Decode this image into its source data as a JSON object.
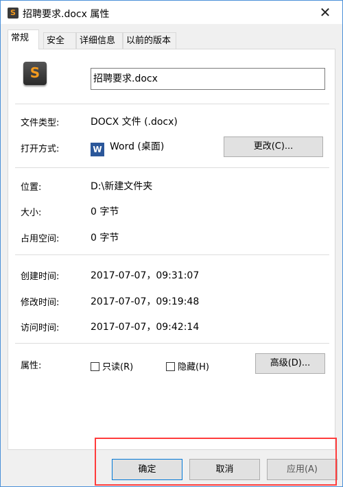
{
  "window": {
    "title": "招聘要求.docx 属性",
    "close_icon": "close-icon"
  },
  "tabs": [
    {
      "label": "常规",
      "active": true
    },
    {
      "label": "安全"
    },
    {
      "label": "详细信息"
    },
    {
      "label": "以前的版本"
    }
  ],
  "general": {
    "file_name": "招聘要求.docx",
    "rows": {
      "type": {
        "label": "文件类型:",
        "value": "DOCX 文件 (.docx)"
      },
      "opens_with": {
        "label": "打开方式:",
        "value": "Word (桌面)",
        "button": "更改(C)..."
      },
      "location": {
        "label": "位置:",
        "value": "D:\\新建文件夹"
      },
      "size": {
        "label": "大小:",
        "value": "0 字节"
      },
      "size_on_disk": {
        "label": "占用空间:",
        "value": "0 字节"
      },
      "created": {
        "label": "创建时间:",
        "value": "2017-07-07，09:31:07"
      },
      "modified": {
        "label": "修改时间:",
        "value": "2017-07-07，09:19:48"
      },
      "accessed": {
        "label": "访问时间:",
        "value": "2017-07-07，09:42:14"
      }
    },
    "attributes": {
      "label": "属性:",
      "readonly": "只读(R)",
      "hidden": "隐藏(H)",
      "advanced": "高级(D)..."
    }
  },
  "footer": {
    "ok": "确定",
    "cancel": "取消",
    "apply": "应用(A)"
  },
  "colors": {
    "highlight": "#ff3b3b",
    "accent": "#0078d7"
  }
}
